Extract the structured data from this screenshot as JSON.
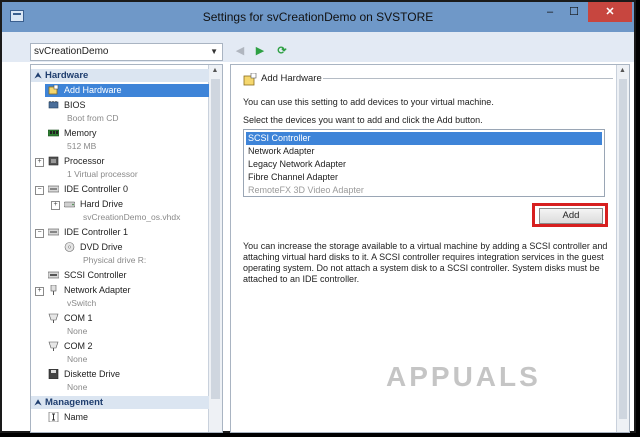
{
  "window": {
    "title": "Settings for svCreationDemo on SVSTORE",
    "min": "–",
    "max": "☐",
    "close": "✕"
  },
  "toolbar": {
    "vm_name": "svCreationDemo",
    "back": "◀",
    "forward": "▶",
    "refresh": "⟳"
  },
  "tree": {
    "hardware_header": "Hardware",
    "management_header": "Management",
    "items": {
      "add_hardware": "Add Hardware",
      "bios": "BIOS",
      "bios_sub": "Boot from CD",
      "memory": "Memory",
      "memory_sub": "512 MB",
      "processor": "Processor",
      "processor_sub": "1 Virtual processor",
      "ide0": "IDE Controller 0",
      "hard_drive": "Hard Drive",
      "hard_drive_sub": "svCreationDemo_os.vhdx",
      "ide1": "IDE Controller 1",
      "dvd": "DVD Drive",
      "dvd_sub": "Physical drive R:",
      "scsi": "SCSI Controller",
      "net": "Network Adapter",
      "net_sub": "vSwitch",
      "com1": "COM 1",
      "com1_sub": "None",
      "com2": "COM 2",
      "com2_sub": "None",
      "diskette": "Diskette Drive",
      "diskette_sub": "None",
      "name": "Name"
    }
  },
  "panel": {
    "group_title": "Add Hardware",
    "intro": "You can use this setting to add devices to your virtual machine.",
    "instruction": "Select the devices you want to add and click the Add button.",
    "devices": [
      "SCSI Controller",
      "Network Adapter",
      "Legacy Network Adapter",
      "Fibre Channel Adapter",
      "RemoteFX 3D Video Adapter"
    ],
    "selected_device": "SCSI Controller",
    "add_label": "Add",
    "info": "You can increase the storage available to a virtual machine by adding a SCSI controller and attaching virtual hard disks to it. A SCSI controller requires integration services in the guest operating system. Do not attach a system disk to a SCSI controller. System disks must be attached to an IDE controller."
  },
  "watermark": "APPUALS",
  "colors": {
    "titlebar": "#6f98c8",
    "selection": "#3e84d8",
    "highlight": "#d71f1f",
    "section_header": "#dbe5f1"
  }
}
